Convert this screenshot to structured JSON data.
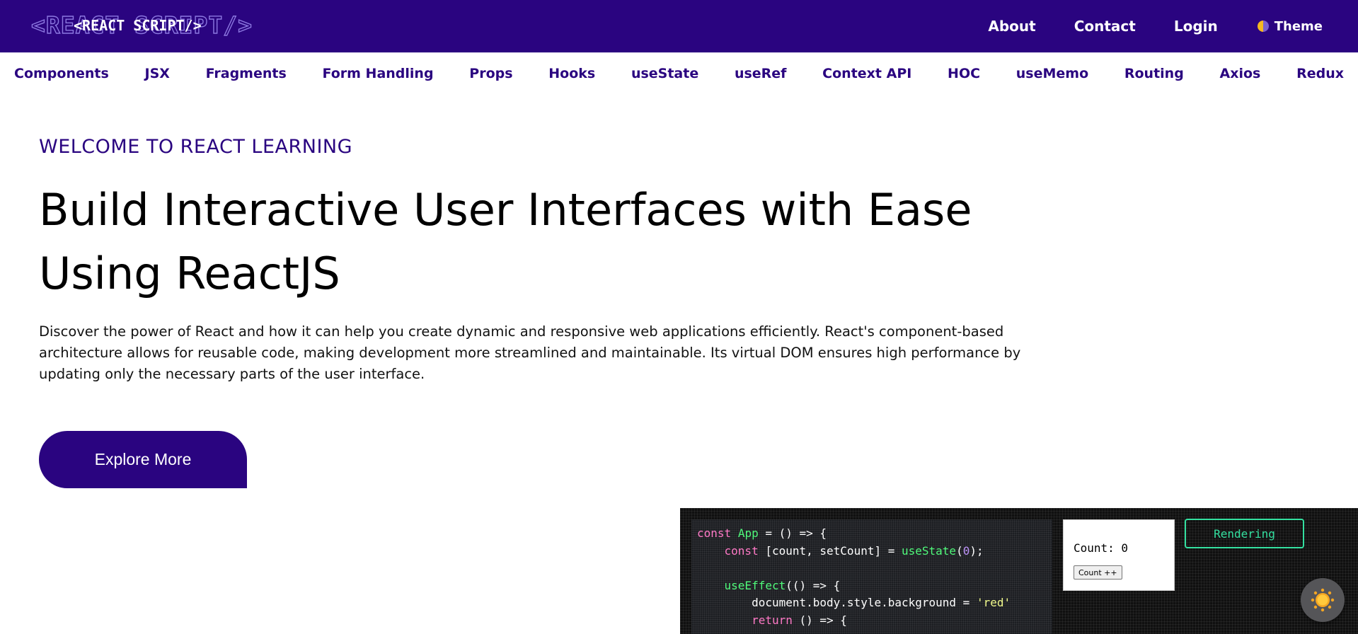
{
  "header": {
    "logo_text": "<REACT SCRIPT/>",
    "nav": [
      "About",
      "Contact",
      "Login"
    ],
    "theme_label": "Theme",
    "theme_icon": "half-circle-icon",
    "bg_color": "#2a0480"
  },
  "subnav": {
    "items": [
      "Components",
      "JSX",
      "Fragments",
      "Form Handling",
      "Props",
      "Hooks",
      "useState",
      "useRef",
      "Context API",
      "HOC",
      "useMemo",
      "Routing",
      "Axios",
      "Redux"
    ]
  },
  "hero": {
    "eyebrow": "WELCOME TO REACT LEARNING",
    "headline_line1": "Build Interactive User Interfaces with Ease",
    "headline_line2": "Using ReactJS",
    "description": "Discover the power of React and how it can help you create dynamic and responsive web applications efficiently. React's component-based architecture allows for reusable code, making development more streamlined and maintainable. Its virtual DOM ensures high performance by updating only the necessary parts of the user interface.",
    "cta_label": "Explore More"
  },
  "demo": {
    "code_lines": [
      "const App = () => {",
      "    const [count, setCount] = useState(0);",
      "",
      "    useEffect(() => {",
      "        document.body.style.background = 'red'",
      "        return () => {"
    ],
    "count_text": "Count: 0",
    "count_button": "Count ++",
    "status_label": "Rendering",
    "accent_color": "#34e0a0"
  },
  "fab": {
    "icon": "sun-icon"
  }
}
